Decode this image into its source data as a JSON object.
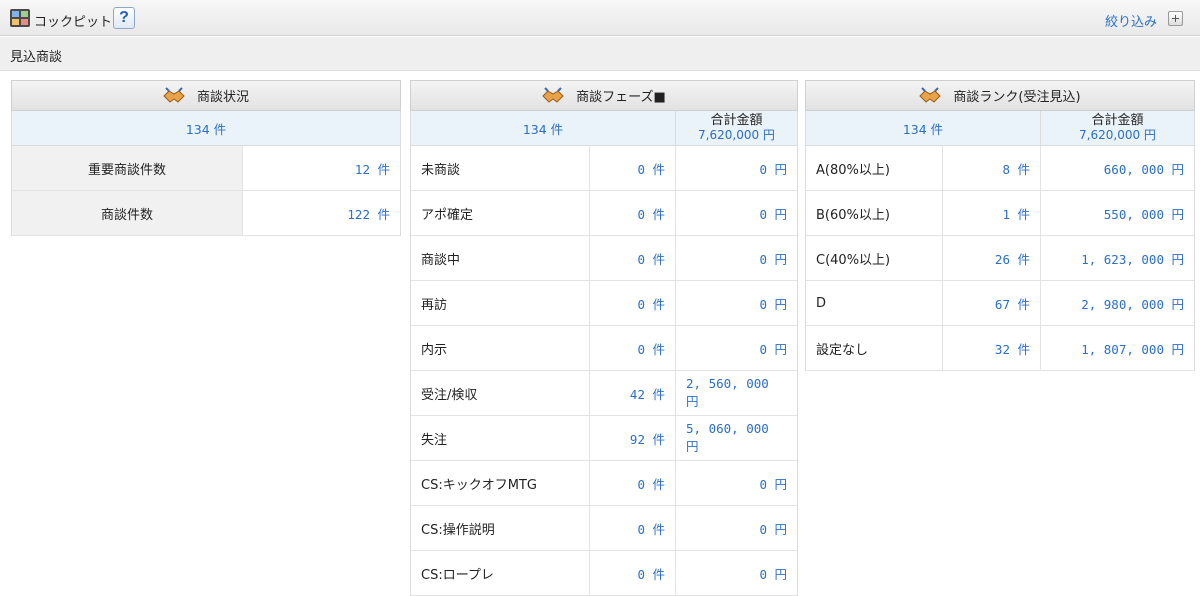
{
  "header": {
    "title": "コックピット",
    "help_label": "?",
    "filter_label": "絞り込み"
  },
  "section": {
    "title": "見込商談"
  },
  "deal_status": {
    "title": "商談状況",
    "total": "134 件",
    "rows": [
      {
        "label": "重要商談件数",
        "count": "12 件"
      },
      {
        "label": "商談件数",
        "count": "122 件"
      }
    ]
  },
  "deal_phase": {
    "title": "商談フェーズ■",
    "total": "134 件",
    "amount_header": "合計金額",
    "amount_total": "7,620,000 円",
    "rows": [
      {
        "label": "未商談",
        "count": "0 件",
        "amount": "0 円"
      },
      {
        "label": "アポ確定",
        "count": "0 件",
        "amount": "0 円"
      },
      {
        "label": "商談中",
        "count": "0 件",
        "amount": "0 円"
      },
      {
        "label": "再訪",
        "count": "0 件",
        "amount": "0 円"
      },
      {
        "label": "内示",
        "count": "0 件",
        "amount": "0 円"
      },
      {
        "label": "受注/検収",
        "count": "42 件",
        "amount": "2, 560, 000 円"
      },
      {
        "label": "失注",
        "count": "92 件",
        "amount": "5, 060, 000 円"
      },
      {
        "label": "CS:キックオフMTG",
        "count": "0 件",
        "amount": "0 円"
      },
      {
        "label": "CS:操作説明",
        "count": "0 件",
        "amount": "0 円"
      },
      {
        "label": "CS:ロープレ",
        "count": "0 件",
        "amount": "0 円"
      }
    ]
  },
  "deal_rank": {
    "title": "商談ランク(受注見込)",
    "total": "134 件",
    "amount_header": "合計金額",
    "amount_total": "7,620,000 円",
    "rows": [
      {
        "label": "A(80%以上)",
        "count": "8 件",
        "amount": "660, 000 円"
      },
      {
        "label": "B(60%以上)",
        "count": "1 件",
        "amount": "550, 000 円"
      },
      {
        "label": "C(40%以上)",
        "count": "26 件",
        "amount": "1, 623, 000 円"
      },
      {
        "label": "D",
        "count": "67 件",
        "amount": "2, 980, 000 円"
      },
      {
        "label": "設定なし",
        "count": "32 件",
        "amount": "1, 807, 000 円"
      }
    ]
  },
  "colors": {
    "link": "#2a6fc9",
    "summary_bg": "#ebf3fa",
    "header_bg": "#e2e2e2"
  },
  "icons": {
    "app": "cockpit-icon",
    "panel": "handshake-icon",
    "expand": "plus-box-icon"
  }
}
